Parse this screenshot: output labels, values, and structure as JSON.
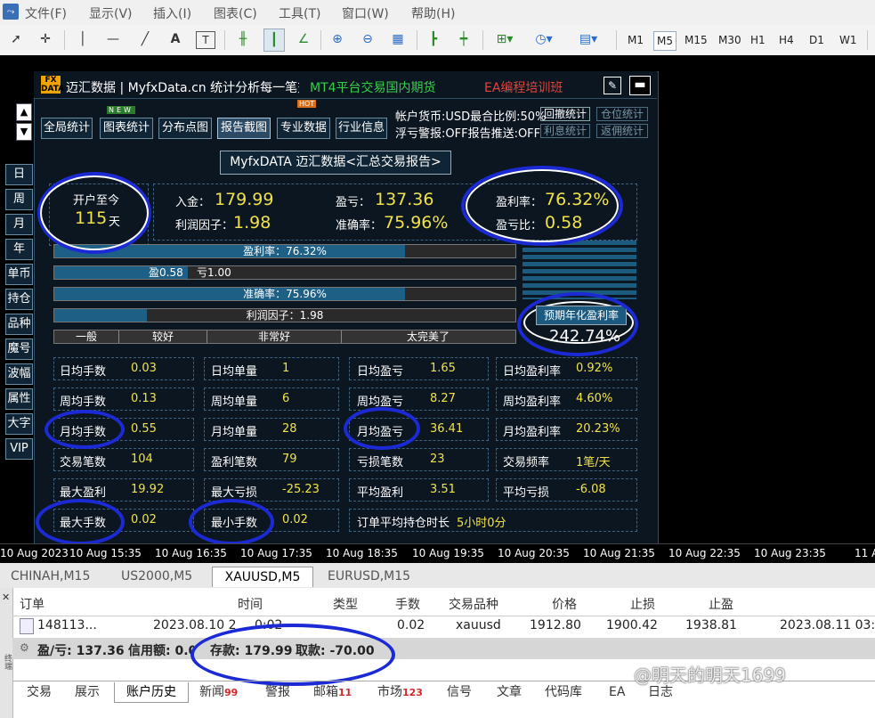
{
  "menubar": {
    "items": [
      "文件(F)",
      "显示(V)",
      "插入(I)",
      "图表(C)",
      "工具(T)",
      "窗口(W)",
      "帮助(H)"
    ]
  },
  "toolbar": {
    "timeframes": [
      "M1",
      "M5",
      "M15",
      "M30",
      "H1",
      "H4",
      "D1",
      "W1"
    ],
    "selected_timeframe": "M5"
  },
  "panel": {
    "logo": "FX DATA",
    "title": "迈汇数据 | MyfxData.cn  统计分析每一笔交易",
    "promo_green": "MT4平台交易国内期货",
    "promo_red": "EA编程培训班",
    "tabs": [
      "全局统计",
      "图表统计",
      "分布点图",
      "报告截图",
      "专业数据",
      "行业信息"
    ],
    "selected_tab": "报告截图",
    "badge_new": "NEW",
    "badge_hot": "HOT",
    "account_line1": "帐户货币:USD最合比例:50%",
    "account_line2": "浮亏警报:OFF报告推送:OFF",
    "right_buttons": [
      "回撤统计",
      "仓位统计",
      "利息统计",
      "返佣统计"
    ],
    "side_nav": [
      "日",
      "周",
      "月",
      "年",
      "单币",
      "持仓",
      "品种",
      "魔号",
      "波幅",
      "属性",
      "大字",
      "VIP"
    ],
    "report_title": "MyfxDATA 迈汇数据<汇总交易报告>",
    "open_since_label": "开户至今",
    "open_days": "115",
    "days_unit": "天",
    "deposit_label": "入金：",
    "deposit_value": "179.99",
    "profit_factor_label": "利润因子：",
    "profit_factor_value": "1.98",
    "pl_label": "盈亏：",
    "pl_value": "137.36",
    "accuracy_label": "准确率：",
    "accuracy_value": "75.96%",
    "profit_rate_label": "盈利率：",
    "profit_rate_value": "76.32%",
    "pl_ratio_label": "盈亏比：",
    "pl_ratio_value": "0.58",
    "bars": {
      "profit_rate": {
        "label": "盈利率：76.32%",
        "fill": 0.76
      },
      "win_loss": {
        "win_label": "盈0.58",
        "loss_label": "亏1.00",
        "fill": 0.29
      },
      "accuracy": {
        "label": "准确率：75.96%",
        "fill": 0.76
      },
      "profit_factor": {
        "label": "利润因子：1.98",
        "fill": 0.2
      }
    },
    "rating_labels": [
      "一般",
      "较好",
      "非常好",
      "太完美了"
    ],
    "annual_label": "预期年化盈利率",
    "annual_value": "242.74%",
    "stats": [
      [
        {
          "label": "日均手数",
          "value": "0.03"
        },
        {
          "label": "日均单量",
          "value": "1"
        },
        {
          "label": "日均盈亏",
          "value": "1.65"
        },
        {
          "label": "日均盈利率",
          "value": "0.92%"
        }
      ],
      [
        {
          "label": "周均手数",
          "value": "0.13"
        },
        {
          "label": "周均单量",
          "value": "6"
        },
        {
          "label": "周均盈亏",
          "value": "8.27"
        },
        {
          "label": "周均盈利率",
          "value": "4.60%"
        }
      ],
      [
        {
          "label": "月均手数",
          "value": "0.55"
        },
        {
          "label": "月均单量",
          "value": "28"
        },
        {
          "label": "月均盈亏",
          "value": "36.41"
        },
        {
          "label": "月均盈利率",
          "value": "20.23%"
        }
      ],
      [
        {
          "label": "交易笔数",
          "value": "104"
        },
        {
          "label": "盈利笔数",
          "value": "79"
        },
        {
          "label": "亏损笔数",
          "value": "23"
        },
        {
          "label": "交易频率",
          "value": "1笔/天"
        }
      ],
      [
        {
          "label": "最大盈利",
          "value": "19.92"
        },
        {
          "label": "最大亏损",
          "value": "-25.23"
        },
        {
          "label": "平均盈利",
          "value": "3.51"
        },
        {
          "label": "平均亏损",
          "value": "-6.08"
        }
      ]
    ],
    "last_row": {
      "max_lots_label": "最大手数",
      "max_lots_value": "0.02",
      "min_lots_label": "最小手数",
      "min_lots_value": "0.02",
      "hold_label": "订单平均持仓时长",
      "hold_value": "5小时0分"
    }
  },
  "time_axis": [
    "10 Aug 2023",
    "10 Aug 15:35",
    "10 Aug 16:35",
    "10 Aug 17:35",
    "10 Aug 18:35",
    "10 Aug 19:35",
    "10 Aug 20:35",
    "10 Aug 21:35",
    "10 Aug 22:35",
    "10 Aug 23:35",
    "11 A"
  ],
  "symbol_tabs": [
    "CHINAH,M15",
    "US2000,M5",
    "XAUUSD,M5",
    "EURUSD,M15"
  ],
  "selected_symbol_tab": "XAUUSD,M5",
  "terminal": {
    "headers": [
      "订单",
      "时间",
      "类型",
      "手数",
      "交易品种",
      "价格",
      "止损",
      "止盈"
    ],
    "row": {
      "order": "148113...",
      "time": "2023.08.10 2",
      "time_tail": "0:02",
      "lots": "0.02",
      "symbol": "xauusd",
      "price": "1912.80",
      "sl": "1900.42",
      "tp": "1938.81",
      "close_time": "2023.08.11 03:"
    },
    "summary": {
      "pl": "盈/亏: 137.36",
      "credit": "信用额: 0.0",
      "deposit": "存款: 179.99",
      "withdraw": "取款: -70.00"
    },
    "bottom_tabs": [
      "交易",
      "展示",
      "账户历史",
      "新闻",
      "警报",
      "邮箱",
      "市场",
      "信号",
      "文章",
      "代码库",
      "EA",
      "日志"
    ],
    "selected_bottom_tab": "账户历史",
    "news_badge": "99",
    "mail_badge": "11",
    "market_badge": "123"
  },
  "watermark": "@明天的明天1699"
}
